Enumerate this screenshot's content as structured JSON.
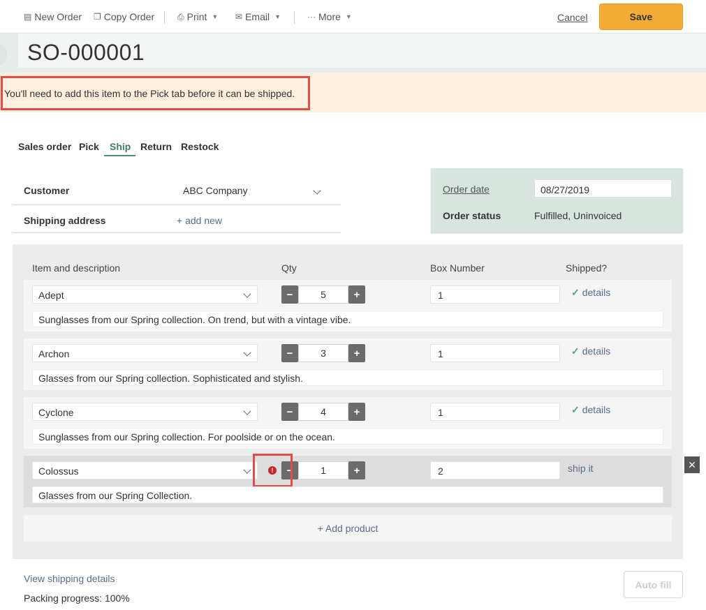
{
  "toolbar": {
    "new_order": "New Order",
    "copy_order": "Copy Order",
    "print": "Print",
    "email": "Email",
    "more": "More",
    "cancel": "Cancel",
    "save": "Save"
  },
  "order": {
    "number": "SO-000001"
  },
  "warning": {
    "text": "You'll need to add this item to the Pick tab before it can be shipped."
  },
  "tabs": [
    {
      "label": "Sales order"
    },
    {
      "label": "Pick"
    },
    {
      "label": "Ship",
      "active": true
    },
    {
      "label": "Return"
    },
    {
      "label": "Restock"
    }
  ],
  "customer": {
    "label": "Customer",
    "value": "ABC Company",
    "shipping_label": "Shipping address",
    "add_new": "+ add new"
  },
  "info": {
    "order_date_label": "Order date",
    "order_date": "08/27/2019",
    "status_label": "Order status",
    "status": "Fulfilled, Uninvoiced"
  },
  "table": {
    "headers": {
      "item": "Item and description",
      "qty": "Qty",
      "box": "Box Number",
      "shipped": "Shipped?"
    },
    "rows": [
      {
        "item": "Adept",
        "qty": "5",
        "box": "1",
        "shipped": "details",
        "desc": "Sunglasses from our Spring collection. On trend, but with a vintage vibe."
      },
      {
        "item": "Archon",
        "qty": "3",
        "box": "1",
        "shipped": "details",
        "desc": "Glasses from our Spring collection. Sophisticated and stylish."
      },
      {
        "item": "Cyclone",
        "qty": "4",
        "box": "1",
        "shipped": "details",
        "desc": "Sunglasses from our Spring collection. For poolside or on the ocean."
      },
      {
        "item": "Colossus",
        "qty": "1",
        "box": "2",
        "shipped": "ship it",
        "desc": "Glasses from our Spring Collection."
      }
    ],
    "add_product": "+ Add product"
  },
  "footer": {
    "view_shipping": "View shipping details",
    "packing_progress": "Packing progress: 100%",
    "auto_fill": "Auto fill"
  },
  "colors": {
    "accent": "#3d7d6a",
    "save": "#f2ac35",
    "warning_bg": "#fcf0dc",
    "highlight_border": "#e54a4a",
    "link": "#5a6c8c"
  }
}
